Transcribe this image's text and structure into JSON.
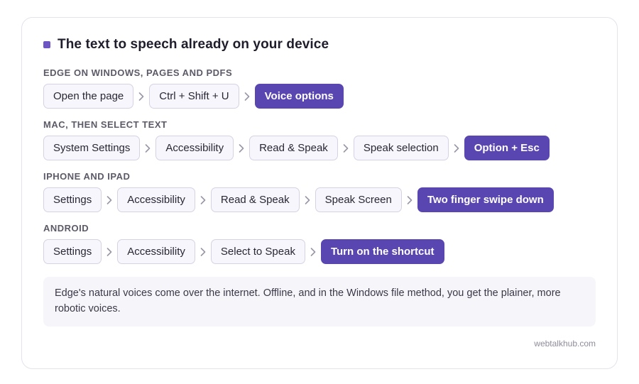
{
  "title": "The text to speech already on your device",
  "sections": [
    {
      "label": "EDGE ON WINDOWS, PAGES AND PDFS",
      "steps": [
        "Open the page",
        "Ctrl + Shift + U"
      ],
      "final": "Voice options"
    },
    {
      "label": "MAC, THEN SELECT TEXT",
      "steps": [
        "System Settings",
        "Accessibility",
        "Read & Speak",
        "Speak selection"
      ],
      "final": "Option + Esc"
    },
    {
      "label": "IPHONE AND IPAD",
      "steps": [
        "Settings",
        "Accessibility",
        "Read & Speak",
        "Speak Screen"
      ],
      "final": "Two finger swipe down"
    },
    {
      "label": "ANDROID",
      "steps": [
        "Settings",
        "Accessibility",
        "Select to Speak"
      ],
      "final": "Turn on the shortcut"
    }
  ],
  "note": "Edge's natural voices come over the internet. Offline, and in the Windows file method, you get the plainer, more robotic voices.",
  "footer": "webtalkhub.com",
  "colors": {
    "accent": "#5a46b0",
    "chip_bg": "#f7f6fc",
    "chip_border": "#d6d2e4"
  },
  "icons": {
    "separator": "chevron-right-icon",
    "title_marker": "square-bullet-icon"
  }
}
